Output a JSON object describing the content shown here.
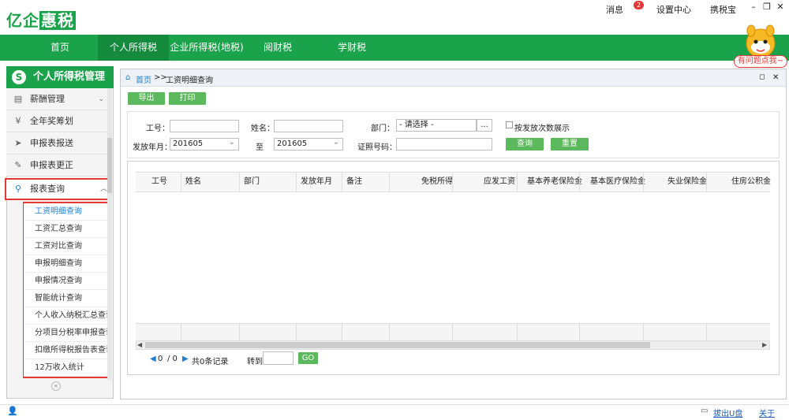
{
  "app": {
    "logo_prefix": "亿企",
    "logo_highlight": "惠税"
  },
  "topbar": {
    "messages": "消息",
    "message_count": "2",
    "settings": "设置中心",
    "tax_assistant": "携税宝",
    "min_icon": "–",
    "restore_icon": "❐",
    "close_icon": "✕"
  },
  "nav": {
    "items": [
      "首页",
      "个人所得税",
      "企业所得税(地税)",
      "阅财税",
      "学财税"
    ],
    "active_index": 1
  },
  "mascot": {
    "bubble": "有问题点我~"
  },
  "sidebar": {
    "title": "个人所得税管理",
    "title_icon": "S",
    "menus": [
      {
        "label": "薪酬管理",
        "icon": "doc-icon"
      },
      {
        "label": "全年奖筹划",
        "icon": "yen-icon"
      },
      {
        "label": "申报表报送",
        "icon": "send-icon"
      },
      {
        "label": "申报表更正",
        "icon": "edit-icon"
      },
      {
        "label": "报表查询",
        "icon": "search-icon"
      }
    ],
    "subitems": [
      "工资明细查询",
      "工资汇总查询",
      "工资对比查询",
      "申报明细查询",
      "申报情况查询",
      "智能统计查询",
      "个人收入纳税汇总查询",
      "分项目分税率申报查询",
      "扣缴所得税报告表查询",
      "12万收入统计"
    ],
    "active_subitem": 0,
    "collapse_icon": "«"
  },
  "breadcrumb": {
    "home": "首页",
    "sep": ">>",
    "current": "工资明细查询"
  },
  "toolbar": {
    "export": "导出",
    "print": "打印"
  },
  "form": {
    "emp_no_label": "工号：",
    "name_label": "姓名：",
    "dept_label": "部门：",
    "dept_value": "- 请选择 -",
    "dept_browse": "...",
    "by_batch_label": "按发放次数展示",
    "period_label": "发放年月：",
    "period_from": "201605",
    "to_label": "至",
    "period_to": "201605",
    "id_label": "证照号码：",
    "query": "查询",
    "reset": "重置"
  },
  "grid": {
    "columns": [
      "工号",
      "姓名",
      "部门",
      "发放年月",
      "备注",
      "免税所得",
      "应发工资",
      "基本养老保险金",
      "基本医疗保险金",
      "失业保险金",
      "住房公积金"
    ]
  },
  "pager": {
    "current": "0",
    "total_pages": "/ 0",
    "records": "共0条记录",
    "goto_label": "转到",
    "go": "GO"
  },
  "statusbar": {
    "eject": "拔出U盘",
    "about": "关于"
  }
}
